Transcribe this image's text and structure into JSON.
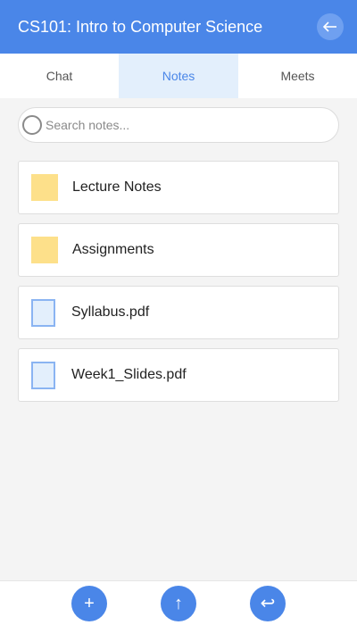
{
  "header": {
    "title": "CS101: Intro to Computer Science",
    "back_icon": "arrow-left-icon"
  },
  "tabs": [
    {
      "label": "Chat",
      "active": false
    },
    {
      "label": "Notes",
      "active": true
    },
    {
      "label": "Meets",
      "active": false
    }
  ],
  "search": {
    "placeholder": "Search notes...",
    "value": "",
    "icon": "search-icon"
  },
  "files": [
    {
      "name": "Lecture Notes",
      "kind": "folder"
    },
    {
      "name": "Assignments",
      "kind": "folder"
    },
    {
      "name": "Syllabus.pdf",
      "kind": "document"
    },
    {
      "name": "Week1_Slides.pdf",
      "kind": "document"
    }
  ],
  "bottom_actions": [
    {
      "name": "add-button",
      "icon": "plus-icon",
      "glyph": "+"
    },
    {
      "name": "upload-button",
      "icon": "arrow-up-icon",
      "glyph": "↑"
    },
    {
      "name": "return-button",
      "icon": "return-arrow-icon",
      "glyph": "↩"
    }
  ],
  "colors": {
    "accent": "#4a86e8",
    "tab_active_bg": "#e3effc",
    "folder": "#fde08a",
    "document_bg": "#e3effc",
    "document_border": "#8ab4f2",
    "background": "#f4f4f4"
  }
}
